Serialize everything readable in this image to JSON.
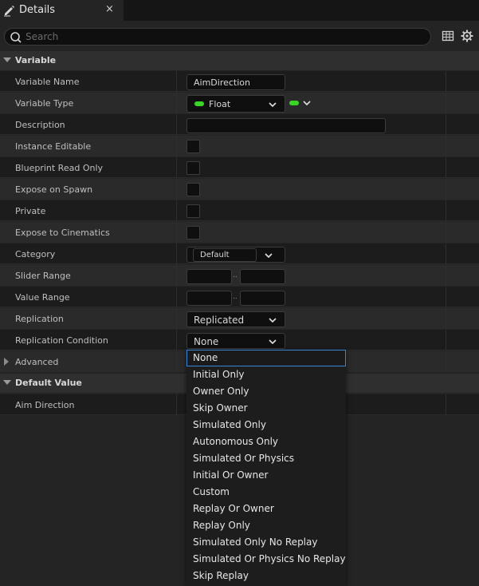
{
  "tab": {
    "title": "Details",
    "icon": "pencil-icon",
    "close": "×"
  },
  "search": {
    "placeholder": "Search"
  },
  "toolbar": {
    "icons": [
      "table-view-icon",
      "settings-gear-icon"
    ]
  },
  "sections": {
    "variable": "Variable",
    "default_value": "Default Value"
  },
  "variable": {
    "name_label": "Variable Name",
    "name_value": "AimDirection",
    "type_label": "Variable Type",
    "type_value": "Float",
    "type_color": "#38d526",
    "description_label": "Description",
    "description_value": "",
    "instance_editable_label": "Instance Editable",
    "blueprint_read_only_label": "Blueprint Read Only",
    "expose_on_spawn_label": "Expose on Spawn",
    "private_label": "Private",
    "expose_to_cinematics_label": "Expose to Cinematics",
    "category_label": "Category",
    "category_value": "Default",
    "slider_range_label": "Slider Range",
    "value_range_label": "Value Range",
    "range_separator": "..",
    "replication_label": "Replication",
    "replication_value": "Replicated",
    "replication_condition_label": "Replication Condition",
    "replication_condition_value": "None",
    "advanced_label": "Advanced"
  },
  "default_value": {
    "aim_direction_label": "Aim Direction"
  },
  "dropdown": {
    "options": [
      "None",
      "Initial Only",
      "Owner Only",
      "Skip Owner",
      "Simulated Only",
      "Autonomous Only",
      "Simulated Or Physics",
      "Initial Or Owner",
      "Custom",
      "Replay Or Owner",
      "Replay Only",
      "Simulated Only No Replay",
      "Simulated Or Physics No Replay",
      "Skip Replay"
    ],
    "selected": "None",
    "highlight_color": "#3a86d6"
  }
}
